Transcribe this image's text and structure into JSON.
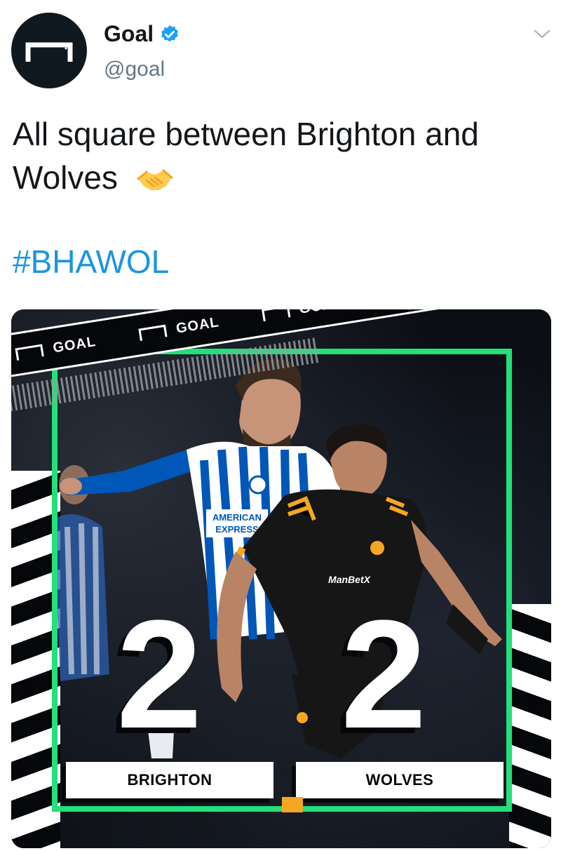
{
  "tweet": {
    "author": {
      "name": "Goal",
      "handle": "@goal",
      "verified": true,
      "avatar_icon": "goal-logo-icon"
    },
    "text_line1": "All square between Brighton and",
    "text_line2": "Wolves",
    "emoji": "handshake-icon",
    "hashtag": "#BHAWOL",
    "menu_icon": "chevron-down-icon"
  },
  "media": {
    "banner_words": [
      "GOAL",
      "GOAL",
      "GOAL"
    ],
    "jersey_sponsor_home": "AMERICAN EXPRESS",
    "jersey_sponsor_away": "ManBetX",
    "score": {
      "home_team": "BRIGHTON",
      "away_team": "WOLVES",
      "home_score": "2",
      "away_score": "2"
    },
    "colors": {
      "frame": "#22e07a",
      "brighton": "#0057b8",
      "wolves": "#f5a623",
      "link": "#1b95e0"
    }
  }
}
